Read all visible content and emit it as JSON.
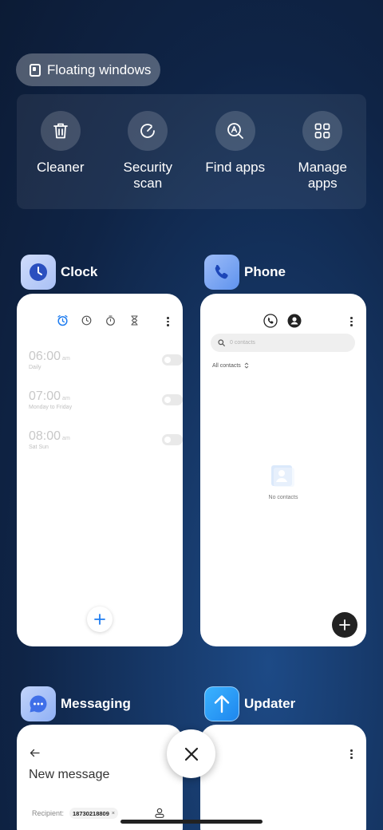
{
  "floating_windows": {
    "label": "Floating windows"
  },
  "tools": [
    {
      "label": "Cleaner",
      "icon": "trash-icon"
    },
    {
      "label": "Security\nscan",
      "icon": "security-scan-icon"
    },
    {
      "label": "Find apps",
      "icon": "find-apps-icon"
    },
    {
      "label": "Manage\napps",
      "icon": "grid-icon"
    }
  ],
  "apps": {
    "clock": {
      "name": "Clock",
      "alarms": [
        {
          "time": "06:00",
          "ampm": "am",
          "repeat": "Daily"
        },
        {
          "time": "07:00",
          "ampm": "am",
          "repeat": "Monday to Friday"
        },
        {
          "time": "08:00",
          "ampm": "am",
          "repeat": "Sat Sun"
        }
      ]
    },
    "phone": {
      "name": "Phone",
      "search_placeholder": "0 contacts",
      "filter_label": "All contacts",
      "empty_label": "No contacts"
    },
    "messaging": {
      "name": "Messaging",
      "title": "New message",
      "recipient_label": "Recipient:",
      "recipient_value": "18730218809"
    },
    "updater": {
      "name": "Updater"
    }
  },
  "colors": {
    "clock_accent": "#1e7cf0",
    "phone_icon_bg": "#5f93ee",
    "messaging_icon_bg": "#4f7ff0",
    "updater_icon_bg": "#1e9cf5"
  }
}
